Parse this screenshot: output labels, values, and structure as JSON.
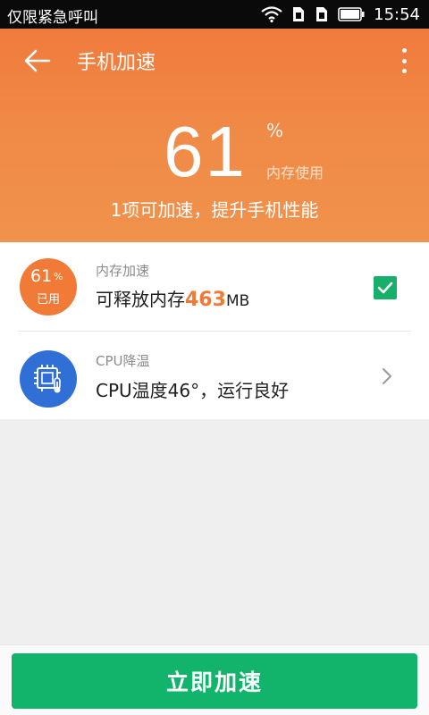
{
  "status_bar": {
    "carrier_text": "仅限紧急呼叫",
    "time": "15:54",
    "icons": [
      "wifi-icon",
      "sim1-icon",
      "sim2-icon",
      "battery-icon"
    ]
  },
  "app_bar": {
    "title": "手机加速",
    "back_icon": "arrow-left-icon",
    "more_icon": "more-vert-icon"
  },
  "summary": {
    "percent_value": "61",
    "percent_sign": "%",
    "percent_label": "内存使用",
    "hint": "1项可加速，提升手机性能"
  },
  "items": [
    {
      "circle_value": "61",
      "circle_percent": "%",
      "circle_label": "已用",
      "subtitle": "内存加速",
      "main_prefix": "可释放内存",
      "main_value": "463",
      "main_unit": "MB",
      "checked": true
    },
    {
      "icon": "cpu-temperature-icon",
      "subtitle": "CPU降温",
      "main_text": "CPU温度46°，运行良好"
    }
  ],
  "action": {
    "label": "立即加速"
  },
  "colors": {
    "header": "#f0763a",
    "accent_orange": "#f07a36",
    "cpu_blue": "#2f6fd6",
    "green": "#11b46a"
  }
}
